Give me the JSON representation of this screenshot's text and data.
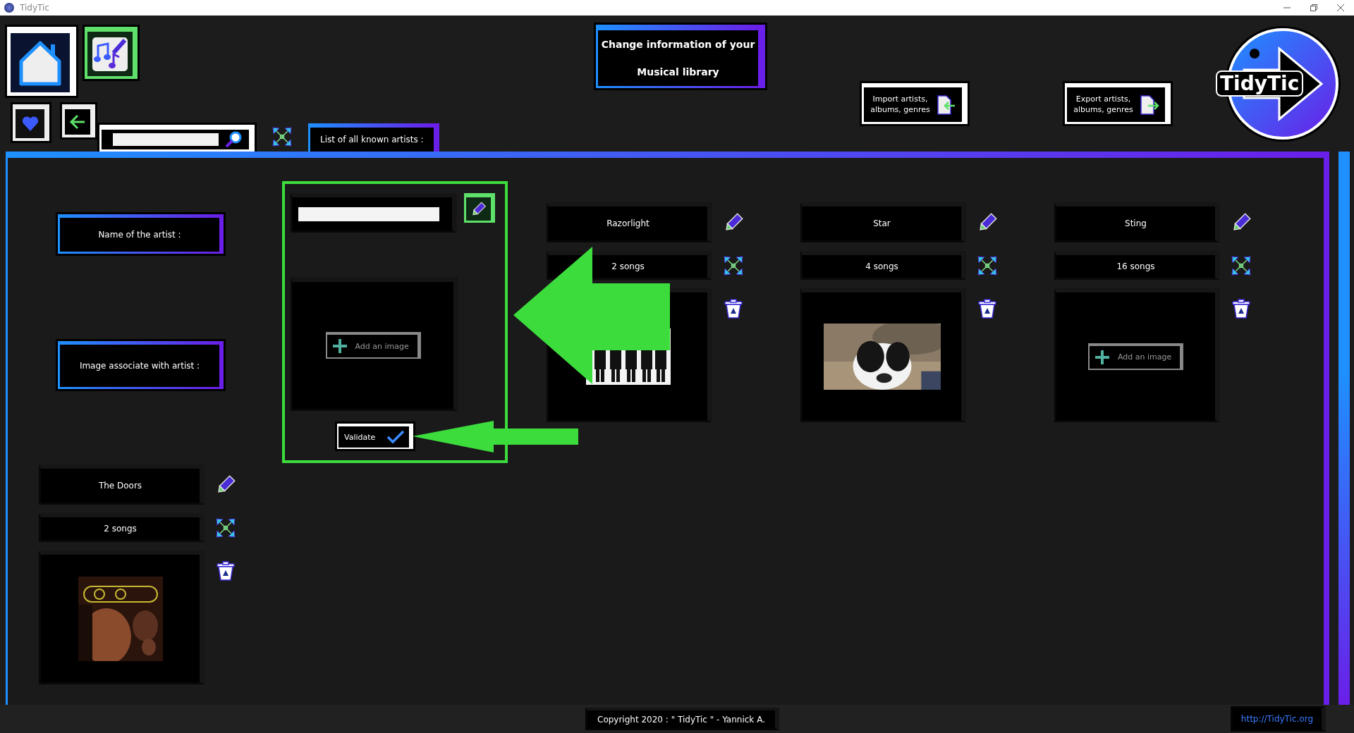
{
  "window": {
    "title": "TidyTic"
  },
  "header": {
    "title_lines": [
      "Change information of your",
      "Musical library"
    ],
    "import_button": "Import artists, albums, genres",
    "export_button": "Export artists, albums, genres",
    "logo": "TidyTic"
  },
  "list_tab": {
    "label": "List of all known artists :"
  },
  "form": {
    "labels": [
      "Name of the artist :",
      "Image associate with artist :"
    ],
    "add_image_label": "Add an image",
    "validate_button": "Validate"
  },
  "artists": [
    {
      "name": "Razorlight",
      "songs": "2 songs"
    },
    {
      "name": "Star",
      "songs": "4 songs"
    },
    {
      "name": "Sting",
      "songs": "16 songs",
      "image": {
        "kind": "empty",
        "add_image_label": "Add an image"
      }
    },
    {
      "name": "The Doors",
      "songs": "2 songs"
    }
  ],
  "footer": {
    "copyright": "Copyright 2020 : \" TidyTic \" - Yannick A.",
    "link": "http://TidyTic.org"
  }
}
